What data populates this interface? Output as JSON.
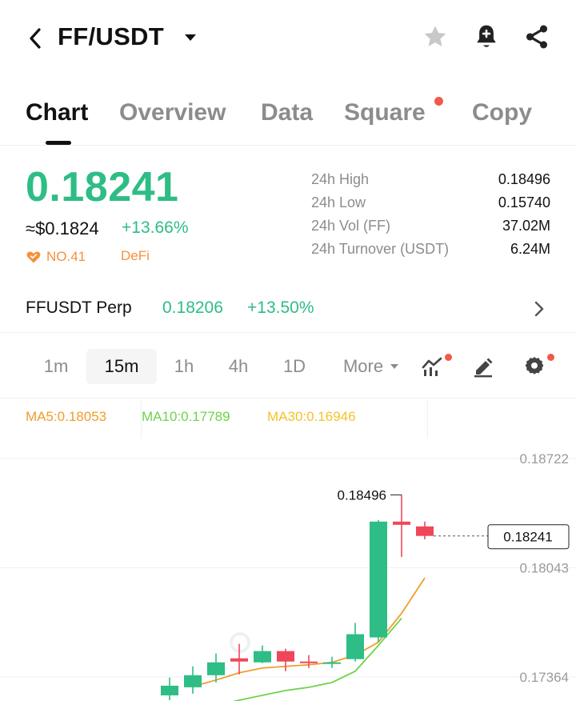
{
  "header": {
    "pair": "FF/USDT"
  },
  "tabs": [
    {
      "label": "Chart",
      "active": true
    },
    {
      "label": "Overview",
      "active": false
    },
    {
      "label": "Data",
      "active": false
    },
    {
      "label": "Square",
      "active": false,
      "badge": true
    },
    {
      "label": "Copy",
      "active": false
    }
  ],
  "ticker": {
    "last_price": "0.18241",
    "usd_price": "≈$0.1824",
    "change": "+13.66%",
    "rank": "NO.41",
    "sector": "DeFi",
    "stats": [
      {
        "label": "24h High",
        "value": "0.18496"
      },
      {
        "label": "24h Low",
        "value": "0.15740"
      },
      {
        "label": "24h Vol (FF)",
        "value": "37.02M"
      },
      {
        "label": "24h Turnover (USDT)",
        "value": "6.24M"
      }
    ]
  },
  "perp": {
    "name": "FFUSDT Perp",
    "price": "0.18206",
    "change": "+13.50%"
  },
  "intervals": [
    {
      "label": "1m",
      "active": false
    },
    {
      "label": "15m",
      "active": true
    },
    {
      "label": "1h",
      "active": false
    },
    {
      "label": "4h",
      "active": false
    },
    {
      "label": "1D",
      "active": false
    }
  ],
  "more_label": "More",
  "ma": {
    "ma5": "MA5:0.18053",
    "ma10": "MA10:0.17789",
    "ma30": "MA30:0.16946"
  },
  "colors": {
    "up": "#2ebd85",
    "down": "#f0465a",
    "ma5": "#f09d2c",
    "ma10": "#6dd44a",
    "ma30": "#f5c12a",
    "accent_orange": "#f5913a"
  },
  "chart_data": {
    "type": "candlestick",
    "y_ticks": [
      "0.18722",
      "0.18043",
      "0.17364"
    ],
    "high_label": "0.18496",
    "last_price_label": "0.18241",
    "candles": [
      {
        "o": 0.1725,
        "c": 0.1731,
        "h": 0.1736,
        "l": 0.1722,
        "up": true
      },
      {
        "o": 0.173,
        "c": 0.17375,
        "h": 0.1743,
        "l": 0.1726,
        "up": true
      },
      {
        "o": 0.17375,
        "c": 0.17455,
        "h": 0.1751,
        "l": 0.1733,
        "up": true
      },
      {
        "o": 0.1748,
        "c": 0.1746,
        "h": 0.1757,
        "l": 0.1738,
        "up": false
      },
      {
        "o": 0.17455,
        "c": 0.17525,
        "h": 0.1756,
        "l": 0.1745,
        "up": true
      },
      {
        "o": 0.17525,
        "c": 0.1746,
        "h": 0.1754,
        "l": 0.174,
        "up": false
      },
      {
        "o": 0.1746,
        "c": 0.17455,
        "h": 0.175,
        "l": 0.1742,
        "up": false
      },
      {
        "o": 0.1745,
        "c": 0.17455,
        "h": 0.1749,
        "l": 0.1742,
        "up": true
      },
      {
        "o": 0.17475,
        "c": 0.1763,
        "h": 0.177,
        "l": 0.1746,
        "up": true
      },
      {
        "o": 0.1761,
        "c": 0.1833,
        "h": 0.1834,
        "l": 0.1758,
        "up": true
      },
      {
        "o": 0.1833,
        "c": 0.1831,
        "h": 0.18496,
        "l": 0.1811,
        "up": false
      },
      {
        "o": 0.183,
        "c": 0.18241,
        "h": 0.1833,
        "l": 0.1822,
        "up": false
      }
    ],
    "ma5": [
      0.17305,
      0.17345,
      0.1739,
      0.1742,
      0.1743,
      0.1744,
      0.17455,
      0.175,
      0.1758,
      0.1776,
      0.1798
    ],
    "ma10": [
      0.1714,
      0.17185,
      0.1722,
      0.1725,
      0.1728,
      0.173,
      0.1733,
      0.174,
      0.1756,
      0.1773
    ]
  }
}
